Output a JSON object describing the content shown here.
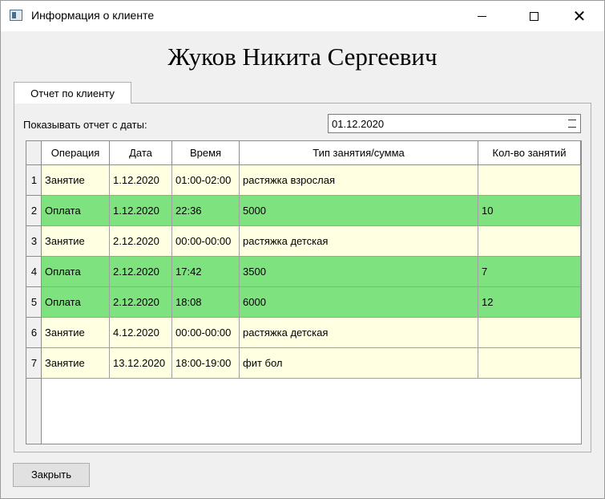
{
  "window": {
    "title": "Информация о клиенте"
  },
  "client": {
    "name": "Жуков Никита Сергеевич"
  },
  "tabs": [
    {
      "label": "Отчет по клиенту"
    }
  ],
  "filter": {
    "label": "Показывать отчет с даты:",
    "date": "01.12.2020"
  },
  "table": {
    "columns": [
      "Операция",
      "Дата",
      "Время",
      "Тип занятия/сумма",
      "Кол-во занятий"
    ],
    "rows": [
      {
        "num": "1",
        "cells": [
          "Занятие",
          "1.12.2020",
          "01:00-02:00",
          "растяжка взрослая",
          ""
        ],
        "kind": "class"
      },
      {
        "num": "2",
        "cells": [
          "Оплата",
          "1.12.2020",
          "22:36",
          "5000",
          "10"
        ],
        "kind": "payment"
      },
      {
        "num": "3",
        "cells": [
          "Занятие",
          "2.12.2020",
          "00:00-00:00",
          "растяжка детская",
          ""
        ],
        "kind": "class"
      },
      {
        "num": "4",
        "cells": [
          "Оплата",
          "2.12.2020",
          "17:42",
          "3500",
          "7"
        ],
        "kind": "payment"
      },
      {
        "num": "5",
        "cells": [
          "Оплата",
          "2.12.2020",
          "18:08",
          "6000",
          "12"
        ],
        "kind": "payment"
      },
      {
        "num": "6",
        "cells": [
          "Занятие",
          "4.12.2020",
          "00:00-00:00",
          "растяжка детская",
          ""
        ],
        "kind": "class"
      },
      {
        "num": "7",
        "cells": [
          "Занятие",
          "13.12.2020",
          "18:00-19:00",
          "фит бол",
          ""
        ],
        "kind": "class"
      }
    ],
    "row_colors": {
      "class": "#ffffe1",
      "payment": "#7ee27e"
    }
  },
  "footer": {
    "close_label": "Закрыть"
  },
  "icons": {
    "app": "window-app-icon",
    "minimize": "minimize-icon",
    "maximize": "maximize-icon",
    "close": "close-icon",
    "spin": "spin-arrows-icon"
  }
}
